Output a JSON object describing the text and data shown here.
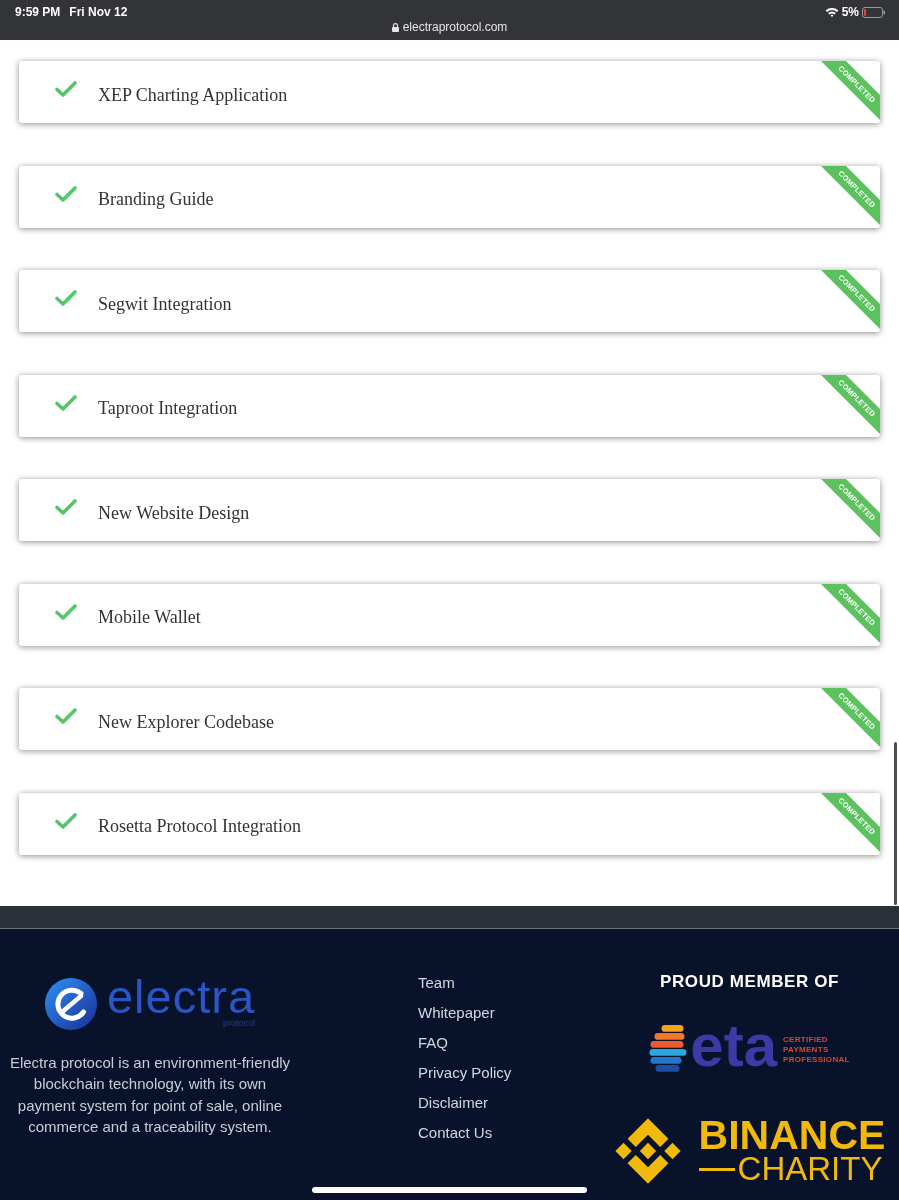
{
  "status_bar": {
    "time": "9:59 PM",
    "date": "Fri Nov 12",
    "url": "electraprotocol.com",
    "battery": "5%"
  },
  "milestones": [
    {
      "title": "XEP Charting Application",
      "checked": true,
      "ribbon": "COMPLETED"
    },
    {
      "title": "Branding Guide",
      "checked": true,
      "ribbon": "COMPLETED"
    },
    {
      "title": "Segwit Integration",
      "checked": true,
      "ribbon": "COMPLETED"
    },
    {
      "title": "Taproot Integration",
      "checked": true,
      "ribbon": "COMPLETED"
    },
    {
      "title": "New Website Design",
      "checked": true,
      "ribbon": "COMPLETED"
    },
    {
      "title": "Mobile Wallet",
      "checked": true,
      "ribbon": "COMPLETED"
    },
    {
      "title": "New Explorer Codebase",
      "checked": true,
      "ribbon": "COMPLETED"
    },
    {
      "title": "Rosetta Protocol Integration",
      "checked": true,
      "ribbon": "COMPLETED"
    }
  ],
  "footer": {
    "brand": {
      "name": "electra",
      "tagline": "protocol"
    },
    "description": "Electra protocol is an environment-friendly blockchain technology, with its own payment system for point of sale, online commerce and a traceability system.",
    "links": [
      "Team",
      "Whitepaper",
      "FAQ",
      "Privacy Policy",
      "Disclaimer",
      "Contact Us"
    ],
    "member_heading": "PROUD MEMBER OF",
    "memberships": [
      {
        "kind": "eta",
        "name": "eta",
        "tagline": [
          "CERTIFIED",
          "PAYMENTS",
          "PROFESSIONAL"
        ]
      },
      {
        "kind": "binance",
        "name": "BINANCE",
        "tagline": "CHARITY"
      }
    ]
  }
}
